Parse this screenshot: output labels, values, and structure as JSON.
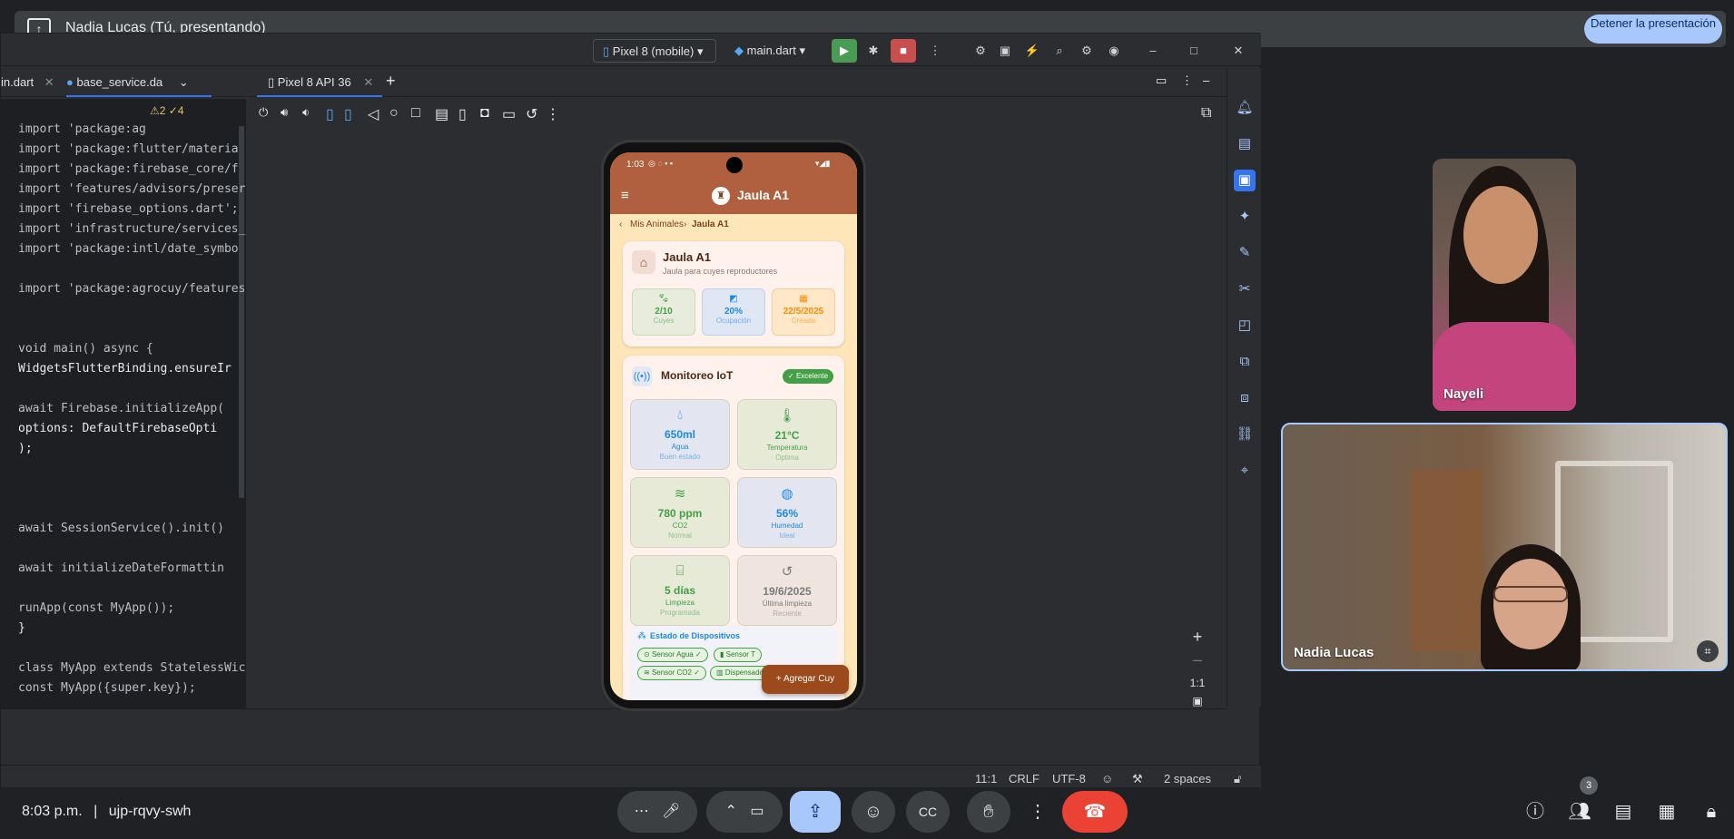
{
  "meet": {
    "presenter_text": "Nadia Lucas (Tú, presentando)",
    "stop_button_label": "Detener la presentación",
    "time": "8:03 p.m.",
    "separator": "|",
    "meeting_code": "ujp-rqvy-swh",
    "people_count": "3",
    "participants": [
      {
        "name": "Nayeli"
      },
      {
        "name": "Nadia Lucas"
      }
    ]
  },
  "ide": {
    "device_selector": "Pixel 8 (mobile)",
    "run_config": "main.dart",
    "editor_tabs": [
      "in.dart",
      "base_service.da"
    ],
    "inspection_badge": "⚠2 ✓4",
    "emulator_tab": "Pixel 8 API 36",
    "zoom_label": "1:1",
    "status": {
      "position": "11:1",
      "line_sep": "CRLF",
      "encoding": "UTF-8",
      "indent": "2 spaces"
    },
    "code_lines": [
      "import 'package:ag",
      "import 'package:flutter/materia",
      "import 'package:firebase_core/f",
      "import 'features/advisors/preser",
      "import 'firebase_options.dart';",
      "import 'infrastructure/services_",
      "import 'package:intl/date_symbo",
      "",
      "import 'package:agrocuy/features",
      "",
      "",
      "void main() async {",
      "  WidgetsFlutterBinding.ensureIr",
      "",
      "  await Firebase.initializeApp(",
      "    options: DefaultFirebaseOpti",
      "  );",
      "",
      "",
      "",
      "  await SessionService().init()",
      "",
      "  await initializeDateFormattin",
      "",
      "  runApp(const MyApp());",
      "}",
      "",
      "class MyApp extends StatelessWic",
      "  const MyApp({super.key});"
    ]
  },
  "app": {
    "status_time": "1:03",
    "title": "Jaula A1",
    "breadcrumb": [
      "Mis Animales",
      "Jaula A1"
    ],
    "cage_card": {
      "title": "Jaula A1",
      "subtitle": "Jaula para cuyes reproductores",
      "stats": [
        {
          "value": "2/10",
          "label": "Cuyes",
          "color": "#43a047"
        },
        {
          "value": "20%",
          "label": "Ocupación",
          "color": "#1e88e5"
        },
        {
          "value": "22/5/2025",
          "label": "Creada",
          "color": "#fb8c00"
        }
      ]
    },
    "iot": {
      "title": "Monitoreo IoT",
      "badge": "Excelente",
      "tiles": [
        {
          "value": "650ml",
          "label": "Agua",
          "sub": "Buen estado",
          "icon": "water-drop-icon",
          "color": "#1e88e5",
          "bg": "#e3e6f0"
        },
        {
          "value": "21°C",
          "label": "Temperatura",
          "sub": "Óptima",
          "icon": "thermometer-icon",
          "color": "#43a047",
          "bg": "#e8ead8"
        },
        {
          "value": "780 ppm",
          "label": "CO2",
          "sub": "Normal",
          "icon": "air-icon",
          "color": "#43a047",
          "bg": "#e8ead8"
        },
        {
          "value": "56%",
          "label": "Humedad",
          "sub": "Ideal",
          "icon": "humidity-icon",
          "color": "#1e88e5",
          "bg": "#e3e6f0"
        },
        {
          "value": "5 días",
          "label": "Limpieza",
          "sub": "Programada",
          "icon": "cleaning-icon",
          "color": "#43a047",
          "bg": "#e8ead8"
        },
        {
          "value": "19/6/2025",
          "label": "Última limpieza",
          "sub": "Reciente",
          "icon": "history-icon",
          "color": "#7a7a7a",
          "bg": "#efe5de"
        }
      ]
    },
    "devices": {
      "title": "Estado de Dispositivos",
      "chips": [
        "Sensor Agua",
        "Sensor T",
        "Sensor CO2",
        "Dispensador"
      ]
    },
    "fab_label": "Agregar Cuy"
  }
}
